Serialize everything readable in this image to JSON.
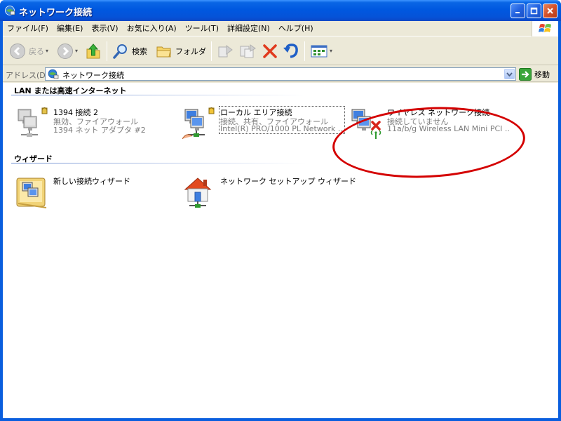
{
  "window": {
    "title": "ネットワーク接続"
  },
  "menu": [
    "ファイル(F)",
    "編集(E)",
    "表示(V)",
    "お気に入り(A)",
    "ツール(T)",
    "詳細設定(N)",
    "ヘルプ(H)"
  ],
  "toolbar": {
    "back_label": "戻る",
    "search_label": "検索",
    "folders_label": "フォルダ"
  },
  "address": {
    "label": "アドレス(D)",
    "value": "ネットワーク接続",
    "go_label": "移動"
  },
  "groups": {
    "lan_header": "LAN または高速インターネット",
    "wizard_header": "ウィザード"
  },
  "connections": [
    {
      "name": "1394 接続 2",
      "status": "無効、ファイアウォール",
      "device": "1394 ネット アダプタ #2"
    },
    {
      "name": "ローカル エリア接続",
      "status": "接続、共有、ファイアウォール",
      "device": "Intel(R) PRO/1000 PL Network ..."
    },
    {
      "name": "ワイヤレス ネットワーク接続",
      "status": "接続していません",
      "device": "11a/b/g Wireless LAN Mini PCI ..."
    }
  ],
  "wizards": [
    {
      "name": "新しい接続ウィザード"
    },
    {
      "name": "ネットワーク セットアップ ウィザード"
    }
  ],
  "colors": {
    "titlebar": "#0058E0",
    "highlight_oval": "#D40000"
  }
}
